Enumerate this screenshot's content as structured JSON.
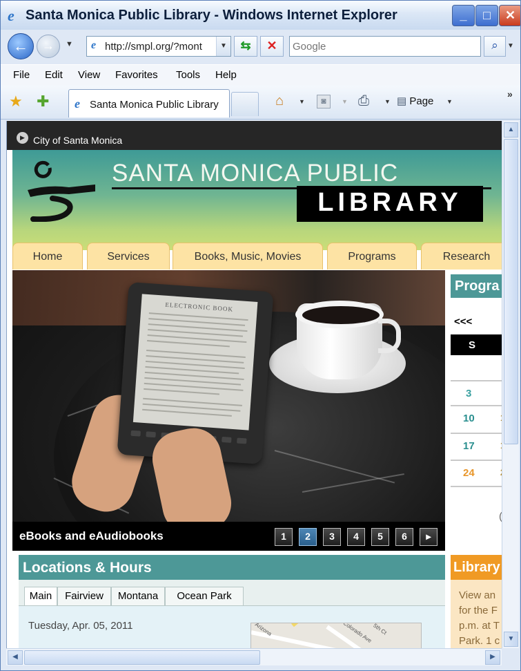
{
  "window": {
    "title": "Santa Monica Public Library - Windows Internet Explorer",
    "controls": {
      "minimize": "_",
      "maximize": "□",
      "close": "✕"
    }
  },
  "address_bar": {
    "url": "http://smpl.org/?mont",
    "search_placeholder": "Google"
  },
  "menu": [
    "File",
    "Edit",
    "View",
    "Favorites",
    "Tools",
    "Help"
  ],
  "command_bar": {
    "tab_label": "Santa Monica Public Library",
    "page_label": "Page",
    "more": "»"
  },
  "page": {
    "city_label": "City of Santa Monica",
    "header": {
      "title_top": "SANTA MONICA PUBLIC",
      "title_bottom": "LIBRARY"
    },
    "nav_tabs": [
      "Home",
      "Services",
      "Books, Music, Movies",
      "Programs",
      "Research"
    ],
    "hero": {
      "ebook_screen_title": "ELECTRONIC BOOK",
      "caption": "eBooks and eAudiobooks",
      "pager": [
        "1",
        "2",
        "3",
        "4",
        "5",
        "6"
      ],
      "pager_active": "2",
      "pager_next": "▸"
    },
    "programs": {
      "heading": "Progra",
      "prev": "<<<",
      "day_header": "S",
      "dates": [
        {
          "day": "3",
          "color": "#3aa0a0"
        },
        {
          "day": "10",
          "color": "#2a8f8f"
        },
        {
          "day": "17",
          "color": "#2a8f8f"
        },
        {
          "day": "24",
          "color": "#e8962a"
        }
      ],
      "side_marks": [
        "1",
        "1",
        "2"
      ],
      "trailing_mark": "("
    },
    "locations": {
      "heading": "Locations & Hours",
      "tabs": [
        "Main",
        "Fairview",
        "Montana",
        "Ocean Park"
      ],
      "active_tab": "Main",
      "date": "Tuesday, Apr. 05, 2011",
      "map_labels": [
        "Colorado Ave",
        "5th Ct",
        "Arizona"
      ]
    },
    "library_box": {
      "heading": "Library",
      "lines": [
        "View an",
        "for the F",
        "p.m. at T",
        "Park. 1 c"
      ]
    }
  },
  "colors": {
    "teal_header": "#4d9897",
    "orange_header": "#f09a24",
    "nav_tab": "#fde3a4",
    "pager_active": "#3a73a3"
  }
}
